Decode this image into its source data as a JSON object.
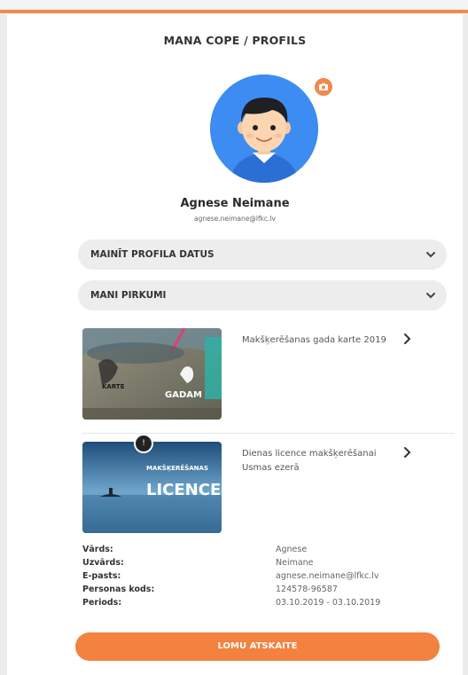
{
  "header": {
    "title": "MANA COPE / PROFILS"
  },
  "profile": {
    "name": "Agnese Neimane",
    "email": "agnese.neimane@lfkc.lv",
    "badge_icon": "camera-icon"
  },
  "sections": [
    {
      "label": "MAINĪT PROFILA DATUS",
      "icon": "chevron-down-icon"
    },
    {
      "label": "MANI PIRKUMI",
      "icon": "chevron-down-icon"
    }
  ],
  "purchases": [
    {
      "title": "Makšķerēšanas gada karte 2019",
      "image_text": [
        "KARTE",
        "GADAM"
      ],
      "icon": "chevron-right-icon"
    },
    {
      "title": "Dienas licence makšķerēšanai Usmas ezerā",
      "image_text": [
        "MAKŠĶERĒŠANAS",
        "LICENCE"
      ],
      "badge": "!",
      "icon": "chevron-right-icon"
    }
  ],
  "details": [
    {
      "label": "Vārds:",
      "value": "Agnese"
    },
    {
      "label": "Uzvārds:",
      "value": "Neimane"
    },
    {
      "label": "E-pasts:",
      "value": "agnese.neimane@lfkc.lv"
    },
    {
      "label": "Personas kods:",
      "value": "124578-96587"
    },
    {
      "label": "Periods:",
      "value": "03.10.2019 - 03.10.2019"
    }
  ],
  "action": {
    "label": "LOMU ATSKAITE"
  },
  "colors": {
    "accent": "#f08a50",
    "avatar_bg": "#3d8cf2",
    "button": "#f3813f"
  }
}
